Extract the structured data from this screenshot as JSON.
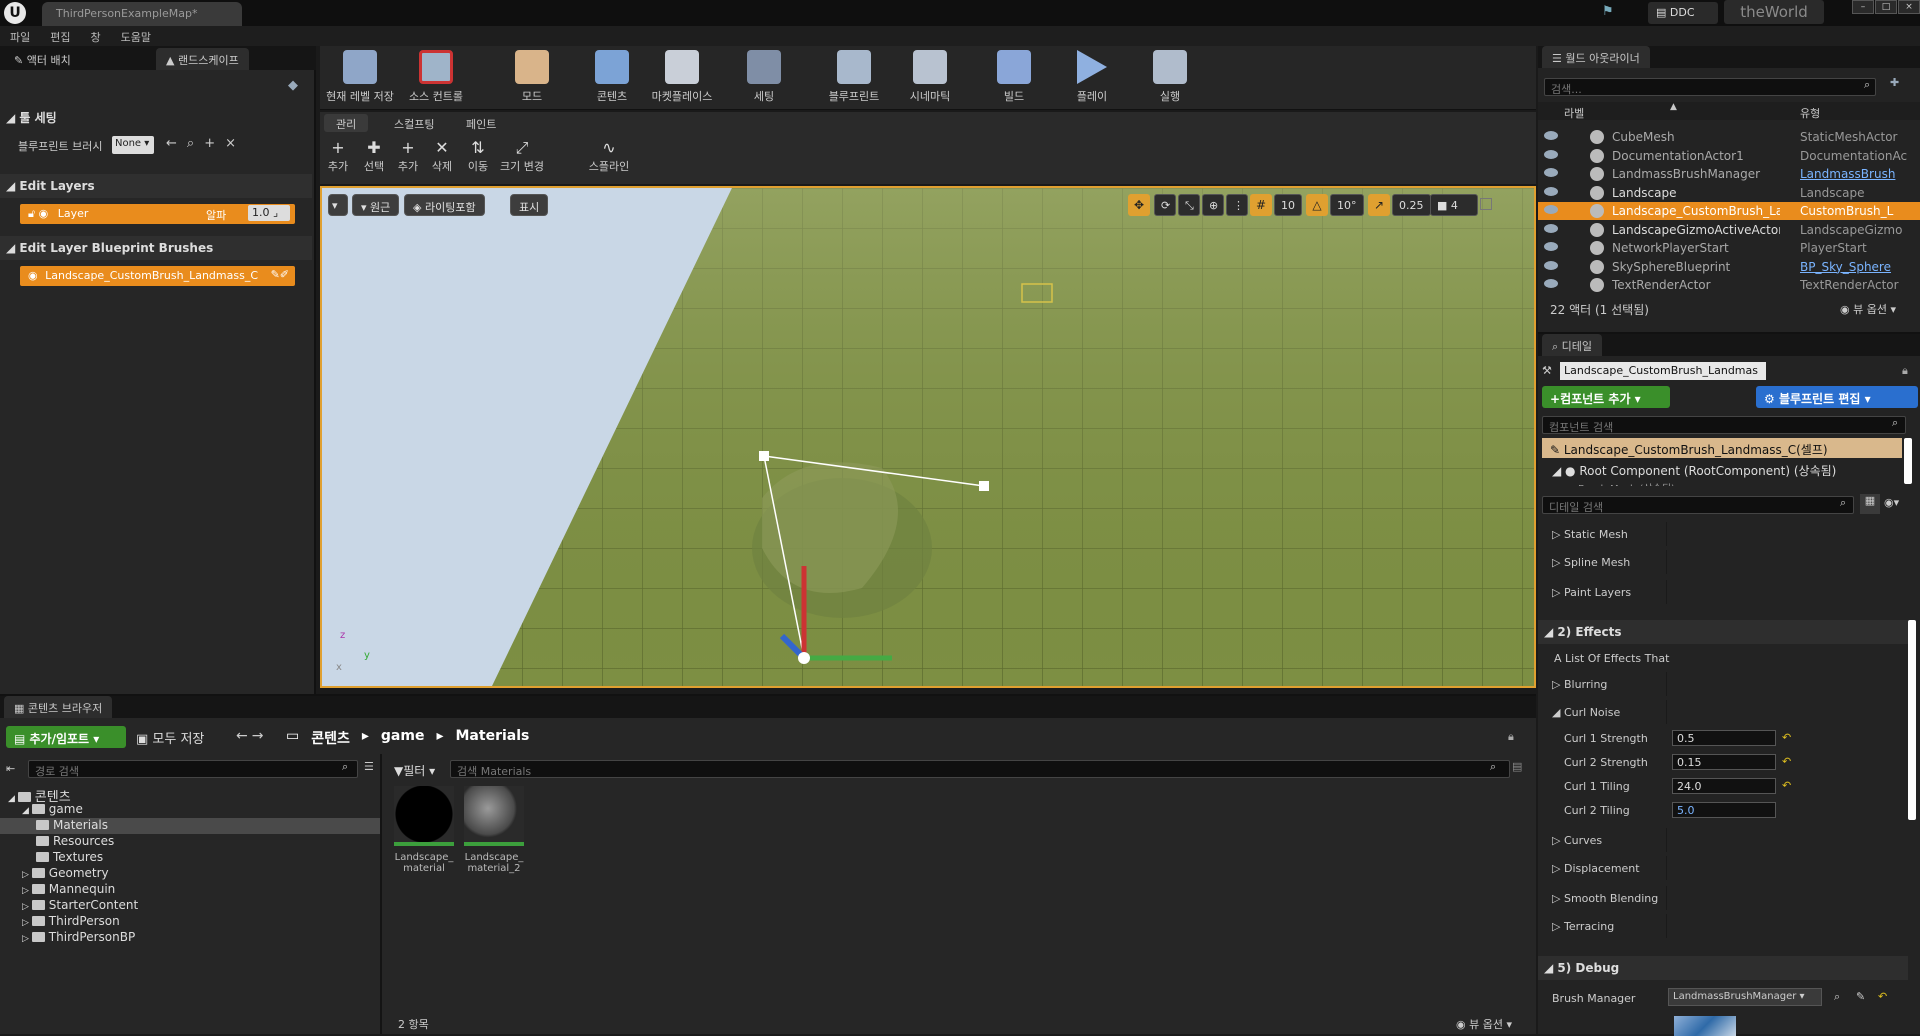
{
  "app": {
    "map_tab": "ThirdPersonExampleMap*",
    "ddc": "DDC",
    "world": "theWorld",
    "logo": "U"
  },
  "window": {
    "min": "–",
    "max": "□",
    "close": "×"
  },
  "menu": [
    "파일",
    "편집",
    "창",
    "도움말"
  ],
  "left": {
    "tabs": [
      "액터 배치",
      "랜드스케이프"
    ],
    "tool_settings": "툴 세팅",
    "bp_brush_label": "블루프린트 브러시",
    "bp_brush_value": "None",
    "edit_layers": "Edit Layers",
    "layer_name": "Layer",
    "alpha_label": "알파",
    "alpha_value": "1.0",
    "edit_layer_bp": "Edit Layer Blueprint Brushes",
    "brush_item": "Landscape_CustomBrush_Landmass_C"
  },
  "toolbar": [
    "현재 레벨 저장",
    "소스 컨트롤",
    "모드",
    "콘텐츠",
    "마켓플레이스",
    "세팅",
    "블루프린트",
    "시네마틱",
    "빌드",
    "플레이",
    "실행"
  ],
  "modes": {
    "tabs": [
      "관리",
      "스컬프팅",
      "페인트"
    ],
    "tools": [
      "추가",
      "선택",
      "추가",
      "삭제",
      "이동",
      "크기 변경",
      "스플라인"
    ]
  },
  "viewport": {
    "perspective": "원근",
    "lighting": "라이팅포함",
    "show": "표시",
    "grid_snap": "10",
    "rot_snap": "10°",
    "scale_snap": "0.25",
    "cam_speed": "4",
    "axis_x": "x",
    "axis_y": "y",
    "axis_z": "z"
  },
  "content_browser": {
    "tab": "콘텐츠 브라우저",
    "add_import": "추가/임포트",
    "save_all": "모두 저장",
    "path": [
      "콘텐츠",
      "game",
      "Materials"
    ],
    "path_search": "경로 검색",
    "filter": "필터",
    "search_placeholder": "검색 Materials",
    "tree": [
      {
        "label": "콘텐츠",
        "depth": 0
      },
      {
        "label": "game",
        "depth": 1
      },
      {
        "label": "Materials",
        "depth": 2
      },
      {
        "label": "Resources",
        "depth": 2
      },
      {
        "label": "Textures",
        "depth": 2
      },
      {
        "label": "Geometry",
        "depth": 1
      },
      {
        "label": "Mannequin",
        "depth": 1
      },
      {
        "label": "StarterContent",
        "depth": 1
      },
      {
        "label": "ThirdPerson",
        "depth": 1
      },
      {
        "label": "ThirdPersonBP",
        "depth": 1
      }
    ],
    "assets": [
      "Landscape_\nmaterial",
      "Landscape_\nmaterial_2"
    ],
    "count": "2 항목",
    "view_options": "뷰 옵션"
  },
  "outliner": {
    "tab": "월드 아웃라이너",
    "search": "검색...",
    "col_label": "라벨",
    "col_type": "유형",
    "rows": [
      {
        "label": "CubeMesh",
        "type": "StaticMeshActor"
      },
      {
        "label": "DocumentationActor1",
        "type": "DocumentationAc"
      },
      {
        "label": "LandmassBrushManager",
        "type": "LandmassBrush"
      },
      {
        "label": "Landscape",
        "type": "Landscape"
      },
      {
        "label": "Landscape_CustomBrush_Landma",
        "type": "CustomBrush_L"
      },
      {
        "label": "LandscapeGizmoActiveActor1",
        "type": "LandscapeGizmo"
      },
      {
        "label": "NetworkPlayerStart",
        "type": "PlayerStart"
      },
      {
        "label": "SkySphereBlueprint",
        "type": "BP_Sky_Sphere"
      },
      {
        "label": "TextRenderActor",
        "type": "TextRenderActor"
      }
    ],
    "summary": "22 액터 (1 선택됨)",
    "view_options": "뷰 옵션"
  },
  "details": {
    "tab": "디테일",
    "name_value": "Landscape_CustomBrush_Landmas",
    "add_component": "컴포넌트 추가",
    "edit_bp": "블루프린트 편집",
    "comp_search": "컴포넌트 검색",
    "self_item": "Landscape_CustomBrush_Landmass_C(셀프)",
    "root_comp": "Root Component (RootComponent) (상속됨)",
    "brush_mesh": "Brush Mesh (상속됨)",
    "detail_search": "디테일 검색",
    "props": [
      {
        "k": "Static Mesh"
      },
      {
        "k": "Spline Mesh"
      },
      {
        "k": "Paint Layers"
      }
    ],
    "effects_cat": "2) Effects",
    "effects_desc": "A List Of Effects That",
    "blurring": "Blurring",
    "curl_noise": "Curl Noise",
    "curl": [
      {
        "k": "Curl 1 Strength",
        "v": "0.5"
      },
      {
        "k": "Curl 2 Strength",
        "v": "0.15"
      },
      {
        "k": "Curl 1 Tiling",
        "v": "24.0"
      },
      {
        "k": "Curl 2 Tiling",
        "v": "5.0"
      }
    ],
    "others": [
      "Curves",
      "Displacement",
      "Smooth Blending",
      "Terracing"
    ],
    "debug_cat": "5) Debug",
    "brush_manager_k": "Brush Manager",
    "brush_manager_v": "LandmassBrushManager"
  },
  "colors": {
    "accent": "#e98c1d",
    "green": "#3a8f2a",
    "blue": "#2a6fcf",
    "grass": "#7d8f43"
  }
}
